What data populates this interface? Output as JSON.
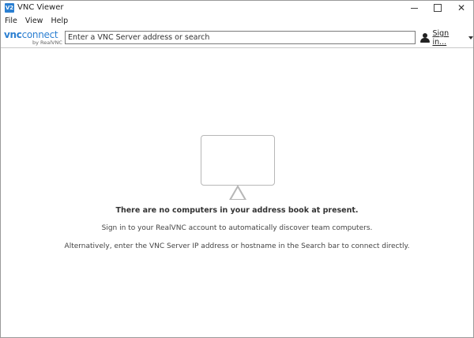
{
  "window": {
    "title": "VNC Viewer",
    "app_icon_label": "V2",
    "controls": {
      "minimize_icon": "minimize-icon",
      "maximize_icon": "maximize-icon",
      "close_icon": "close-icon",
      "close_glyph": "✕"
    }
  },
  "menu": {
    "items": [
      "File",
      "View",
      "Help"
    ]
  },
  "toolbar": {
    "logo": {
      "vnc": "vnc",
      "connect": "connect",
      "by": "by RealVNC"
    },
    "search": {
      "placeholder": "Enter a VNC Server address or search",
      "value": ""
    },
    "signin_label": "Sign in...",
    "user_icon": "user-icon",
    "chevron_icon": "chevron-down-icon"
  },
  "main": {
    "monitor_icon": "monitor-icon",
    "empty_heading": "There are no computers in your address book at present.",
    "empty_line1": "Sign in to your RealVNC account to automatically discover team computers.",
    "empty_line2": "Alternatively, enter the VNC Server IP address or hostname in the Search bar to connect directly."
  },
  "colors": {
    "brand": "#2b7fd1",
    "border": "#9a9a9a",
    "icon_gray": "#b7b7b7"
  }
}
